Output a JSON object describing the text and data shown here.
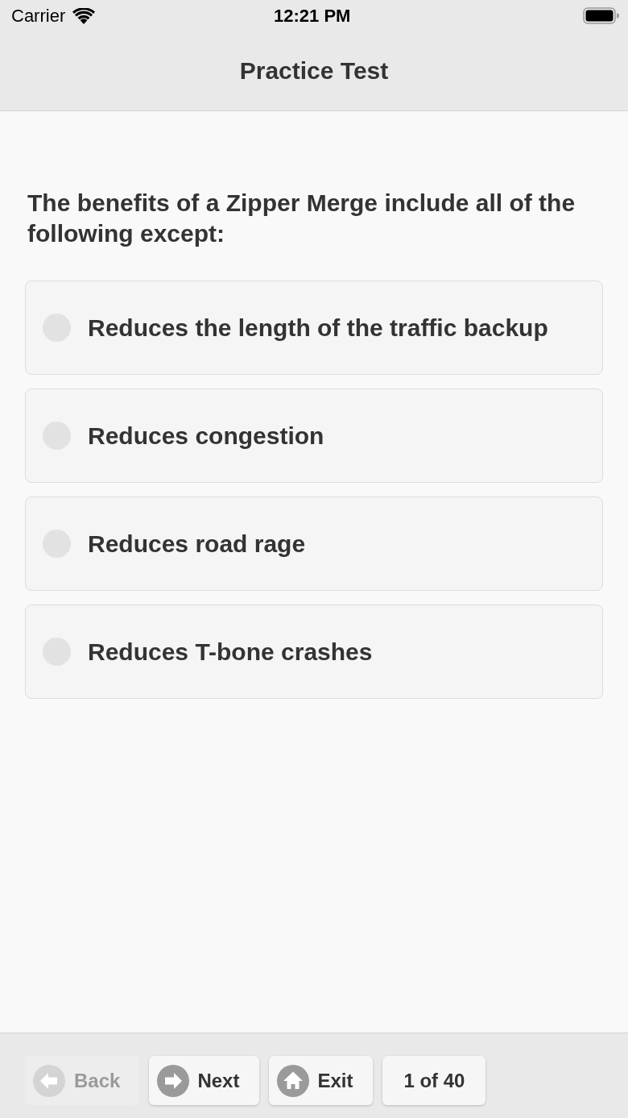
{
  "status_bar": {
    "carrier": "Carrier",
    "time": "12:21 PM"
  },
  "nav_bar": {
    "title": "Practice Test"
  },
  "question": {
    "text": "The benefits of a Zipper Merge include all of the following except:",
    "options": [
      {
        "label": "Reduces the length of the traffic backup",
        "selected": false
      },
      {
        "label": "Reduces congestion",
        "selected": false
      },
      {
        "label": "Reduces road rage",
        "selected": false
      },
      {
        "label": "Reduces T-bone crashes",
        "selected": false
      }
    ]
  },
  "toolbar": {
    "buttons": [
      {
        "kind": "back",
        "label": "Back",
        "disabled": true
      },
      {
        "kind": "next",
        "label": "Next",
        "disabled": false
      },
      {
        "kind": "exit",
        "label": "Exit",
        "disabled": false
      }
    ],
    "counter": "1 of 40"
  }
}
